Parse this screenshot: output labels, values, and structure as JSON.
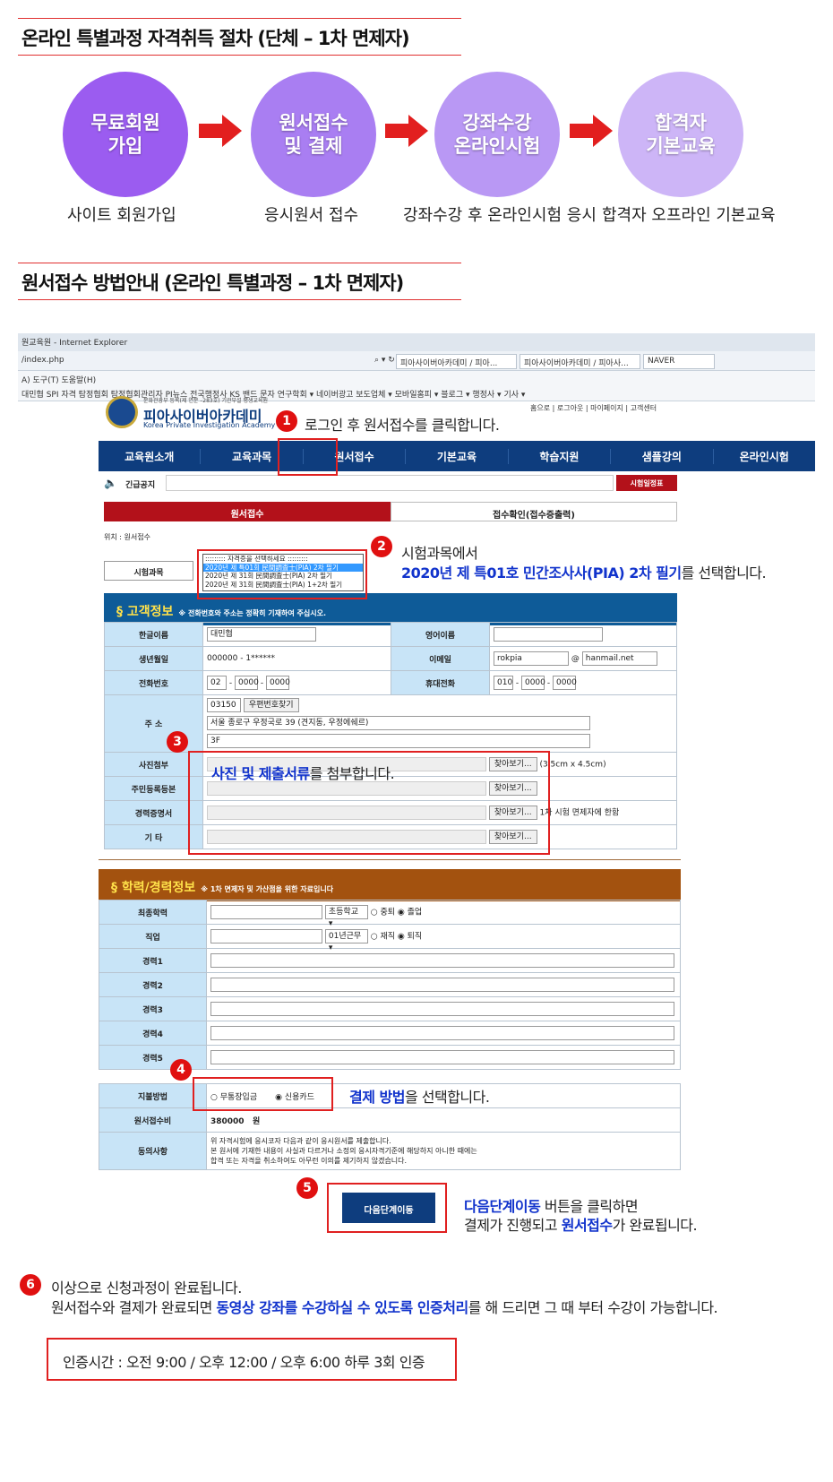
{
  "section1_title": "온라인 특별과정 자격취득 절차  (단체 – 1차 면제자)",
  "steps": [
    {
      "label": "무료회원\n가입",
      "caption": "사이트 회원가입",
      "color": "#9b5cf0"
    },
    {
      "label": "원서접수\n및 결제",
      "caption": "응시원서 접수",
      "color": "#a97ef2"
    },
    {
      "label": "강좌수강\n온라인시험",
      "caption": "강좌수강 후 온라인시험 응시",
      "color": "#b998f4"
    },
    {
      "label": "합격자\n기본교육",
      "caption": "합격자 오프라인  기본교육",
      "color": "#cdb5f7"
    }
  ],
  "section2_title": "원서접수 방법안내  (온라인 특별과정 – 1차 면제자)",
  "browser": {
    "title": "원교육원 - Internet Explorer",
    "address": "/index.php",
    "tabs": [
      "피아사이버아카데미 / 피아...",
      "피아사이버아카데미 / 피아사...",
      "NAVER"
    ],
    "menu": "A)   도구(T)   도움말(H)",
    "favorites": "대민협  SPI  자격  탐정협회  탐정협회관리자  PI뉴스  전국행정사  KS  밴드  문자  연구학회 ▾  네이버광고  보도업체 ▾  모바일홈피 ▾  블로그 ▾  행정사 ▾  기사 ▾"
  },
  "site": {
    "logo_sub": "문화관광부 등록(제 연분 –283호) 기관부설 평생교육원",
    "logo_main": "피아사이버아카데미",
    "logo_en": "Korea Private Investigation Academy",
    "toplinks": "홈으로  |  로그아웃  |  마이페이지  |  고객센터",
    "nav": [
      "교육원소개",
      "교육과목",
      "원서접수",
      "기본교육",
      "학습지원",
      "샘플강의",
      "온라인시험"
    ],
    "notice_label": "긴급공지",
    "notice_btn": "시험일정표",
    "tab_active": "원서접수",
    "tab_other": "접수확인(접수증출력)",
    "location": "위치 : 원서접수",
    "exam_label": "시험과목",
    "exam_options": [
      "::::::::: 자격증을 선택하세요 :::::::::",
      "2020년 제 특01회 民間調査士(PIA) 2차 필기",
      "2020년 제 31회 民間調査士(PIA) 2차 필기",
      "2020년 제 31회 民間調査士(PIA) 1+2차 필기"
    ]
  },
  "customer": {
    "header": "§  고객정보",
    "header_note": "※ 전화번호와 주소는 정확히 기재하여 주십시오.",
    "name_label": "한글이름",
    "name": "대민협",
    "eng_label": "영어이름",
    "birth_label": "생년월일",
    "birth": "000000 - 1******",
    "email_label": "이메일",
    "email_id": "rokpia",
    "email_at": "@",
    "email_domain": "hanmail.net",
    "phone_label": "전화번호",
    "phone": [
      "02",
      "0000",
      "0000"
    ],
    "mobile_label": "휴대전화",
    "mobile": [
      "010",
      "0000",
      "0000"
    ],
    "addr_label": "주 소",
    "zip": "03150",
    "zip_btn": "우편번호찾기",
    "addr1": "서울 종로구 우정국로 39 (견지동, 우정에쉐르)",
    "addr2": "3F",
    "photo_label": "사진첨부",
    "photo_note": "(3.5cm x 4.5cm)",
    "resident_label": "주민등록등본",
    "career_label": "경력증명서",
    "career_note": "1차 시험 면제자에 한함",
    "etc_label": "기 타",
    "browse": "찾아보기..."
  },
  "edu": {
    "header": "§  학력/경력정보",
    "header_note": "※ 1차 면제자 및 가산점을 위한 자료입니다",
    "final_label": "최종학력",
    "final_sel": "초등학교 ▾",
    "final_r1": "중퇴",
    "final_r2": "졸업",
    "job_label": "직업",
    "job_sel": "01년근무 ▾",
    "job_r1": "재직",
    "job_r2": "퇴직",
    "careers": [
      "경력1",
      "경력2",
      "경력3",
      "경력4",
      "경력5"
    ],
    "pay_label": "지불방법",
    "pay_r1": "무통장입금",
    "pay_r2": "신용카드",
    "fee_label": "원서접수비",
    "fee": "380000",
    "fee_unit": "원",
    "agree_label": "동의사항",
    "agree": [
      "위 자격시험에 응시코자 다음과 같이 응시원서를 제출합니다.",
      "본 원서에 기재한 내용이 사실과 다르거나 소정의 응시자격기준에 해당하지 아니한 때에는",
      "합격 또는 자격을 취소하여도 아무런 이의를 제기하지 않겠습니다."
    ],
    "next_btn": "다음단계이동"
  },
  "notes": {
    "n1": "로그인 후 원서접수를 클릭합니다.",
    "n2a": "시험과목에서",
    "n2b": "2020년 제 특01호 민간조사사(PIA) 2차 필기",
    "n2c": "를 선택합니다.",
    "n3a": "사진 및 제출서류",
    "n3b": "를 첨부합니다.",
    "n4a": "결제 방법",
    "n4b": "을 선택합니다.",
    "n5a": "다음단계이동",
    "n5b": " 버튼을 클릭하면",
    "n5c": "결제가 진행되고 ",
    "n5d": "원서접수",
    "n5e": "가 완료됩니다.",
    "n6a": "이상으로 신청과정이 완료됩니다.",
    "n6b": "원서접수와 결제가 완료되면 ",
    "n6c": "동영상 강좌를 수강하실 수 있도록 인증처리",
    "n6d": "를 해 드리면 그 때 부터 수강이 가능합니다.",
    "final": "인증시간 : 오전 9:00 / 오후 12:00  / 오후  6:00   하루 3회 인증"
  },
  "badges": [
    "1",
    "2",
    "3",
    "4",
    "5",
    "6"
  ]
}
